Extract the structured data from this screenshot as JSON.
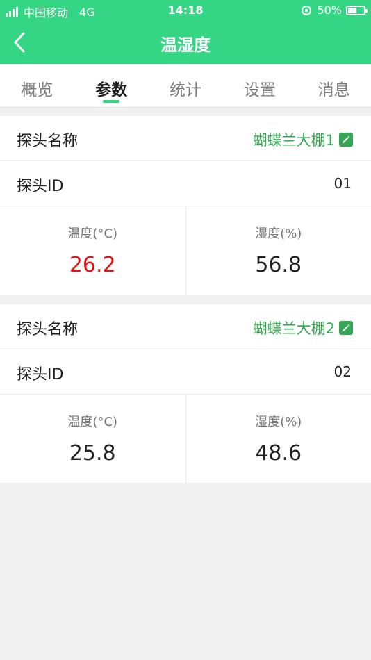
{
  "status_bar": {
    "carrier": "中国移动",
    "network": "4G",
    "time": "14:18",
    "battery": "50%",
    "battery_level": 0.5
  },
  "nav": {
    "title": "温湿度",
    "back_icon": "back-chevron-icon"
  },
  "tabs": [
    {
      "label": "概览",
      "active": false
    },
    {
      "label": "参数",
      "active": true
    },
    {
      "label": "统计",
      "active": false
    },
    {
      "label": "设置",
      "active": false
    },
    {
      "label": "消息",
      "active": false
    }
  ],
  "probes": [
    {
      "name_label": "探头名称",
      "name": "蝴蝶兰大棚1",
      "id_label": "探头ID",
      "id": "01",
      "temp_label": "温度(°C)",
      "temp": "26.2",
      "temp_alert": true,
      "humidity_label": "湿度(%)",
      "humidity": "56.8"
    },
    {
      "name_label": "探头名称",
      "name": "蝴蝶兰大棚2",
      "id_label": "探头ID",
      "id": "02",
      "temp_label": "温度(°C)",
      "temp": "25.8",
      "temp_alert": false,
      "humidity_label": "湿度(%)",
      "humidity": "48.6"
    }
  ],
  "colors": {
    "primary": "#35d683",
    "name_text": "#35a853",
    "alert": "#ee1111"
  }
}
